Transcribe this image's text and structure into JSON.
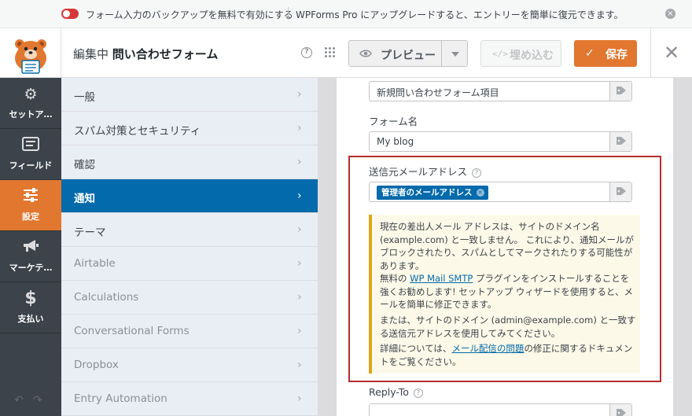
{
  "notice": {
    "toggle_text": "フォーム入力のバックアップを無料で有効にする",
    "upgrade_text": "WPForms Pro にアップグレードすると、エントリーを簡単に復元できます。"
  },
  "header": {
    "editing_prefix": "編集中",
    "form_title": "問い合わせフォーム",
    "preview_label": "プレビュー",
    "embed_label": "埋め込む",
    "save_label": "保存"
  },
  "iconbar": {
    "items": [
      {
        "label": "セットア…",
        "icon": "gear-icon"
      },
      {
        "label": "フィールド",
        "icon": "fields-icon"
      },
      {
        "label": "設定",
        "icon": "sliders-icon",
        "active": true
      },
      {
        "label": "マーケテ…",
        "icon": "megaphone-icon"
      },
      {
        "label": "支払い",
        "icon": "dollar-icon"
      }
    ]
  },
  "menu": {
    "items": [
      {
        "label": "一般"
      },
      {
        "label": "スパム対策とセキュリティ"
      },
      {
        "label": "確認"
      },
      {
        "label": "通知",
        "active": true
      },
      {
        "label": "テーマ"
      },
      {
        "label": "Airtable"
      },
      {
        "label": "Calculations"
      },
      {
        "label": "Conversational Forms"
      },
      {
        "label": "Dropbox"
      },
      {
        "label": "Entry Automation"
      }
    ]
  },
  "content": {
    "subject_value": "新規問い合わせフォーム項目",
    "form_name_label": "フォーム名",
    "form_name_value": "My blog",
    "from_email_label": "送信元メールアドレス",
    "from_email_chip": "管理者のメールアドレス",
    "alert": {
      "p1": "現在の差出人メール アドレスは、サイトのドメイン名 (example.com) と一致しません。 これにより、通知メールがブロックされたり、スパムとしてマークされたりする可能性があります。",
      "p2_pre": "無料の ",
      "p2_link": "WP Mail SMTP",
      "p2_post": " プラグインをインストールすることを強くお勧めします! セットアップ ウィザードを使用すると、メールを簡単に修正できます。",
      "p3": "または、サイトのドメイン (admin@example.com) と一致する送信元アドレスを使用してみてください。",
      "p4_pre": "詳細については、",
      "p4_link": "メール配信の問題",
      "p4_post": "の修正に関するドキュメントをご覧ください。"
    },
    "reply_to_label": "Reply-To"
  },
  "colors": {
    "accent_orange": "#e27730",
    "active_blue": "#036aab",
    "highlight_red": "#b32d2e",
    "alert_yellow": "#dba617"
  }
}
